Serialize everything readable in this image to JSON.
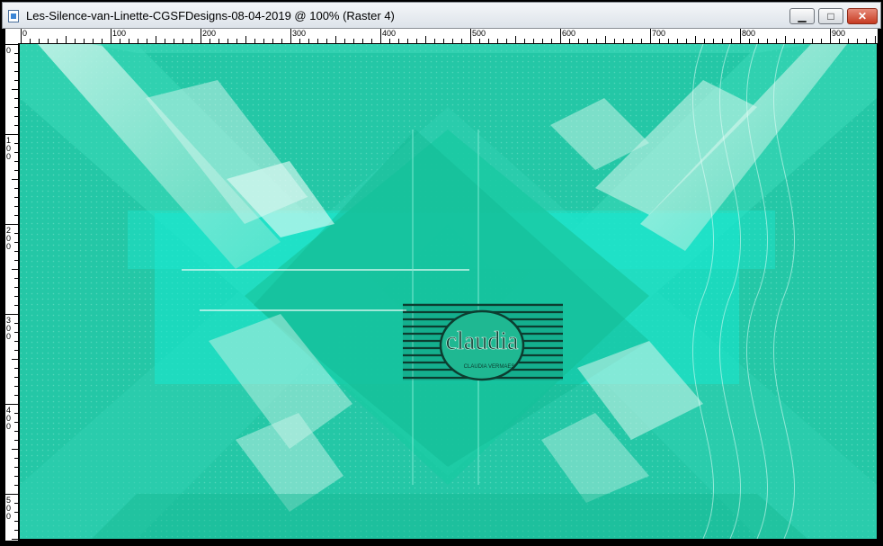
{
  "window": {
    "title": "Les-Silence-van-Linette-CGSFDesigns-08-04-2019 @ 100% (Raster 4)",
    "buttons": {
      "minimize": "▁",
      "maximize": "□",
      "close": "✕"
    }
  },
  "rulers": {
    "top_labels": [
      "0",
      "100",
      "200",
      "300",
      "400",
      "500",
      "600",
      "700",
      "800",
      "900"
    ],
    "left_labels": [
      "0",
      "100",
      "200",
      "300",
      "400",
      "500"
    ]
  },
  "watermark": {
    "name": "claudia",
    "subtitle": "CLAUDIA VERMAES"
  },
  "colors": {
    "background": "#20c9a8",
    "accent_cyan": "#16e8d0",
    "pale_mint": "#b9efe1",
    "dark_teal": "#0aa883",
    "stamp_dark": "#0c3d30"
  }
}
